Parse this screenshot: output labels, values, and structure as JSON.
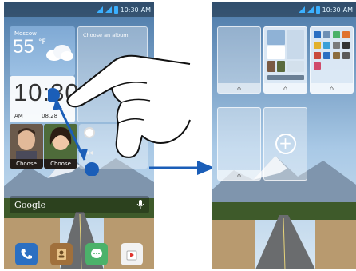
{
  "left_screen": {
    "status": {
      "time": "10:30",
      "am": "AM"
    },
    "weather": {
      "city": "Moscow",
      "temperature": "55",
      "unit": "°F"
    },
    "album": {
      "label": "Choose an album"
    },
    "clock": {
      "time": "10:30",
      "ampm": "AM",
      "date": "08.28"
    },
    "contacts": [
      {
        "label": "Choose"
      },
      {
        "label": "Choose"
      }
    ],
    "search": {
      "brand": "Google"
    },
    "dock": [
      {
        "icon": "phone-icon"
      },
      {
        "icon": "contacts-icon"
      },
      {
        "icon": "messaging-icon"
      },
      {
        "icon": "app-store-icon"
      }
    ]
  },
  "right_screen": {
    "status": {
      "time": "10:30",
      "am": "AM"
    },
    "add_symbol": "+"
  },
  "colors": {
    "sky": "#8fb7da",
    "road": "#6a6c6e",
    "accent_blue": "#1b5eb8"
  }
}
